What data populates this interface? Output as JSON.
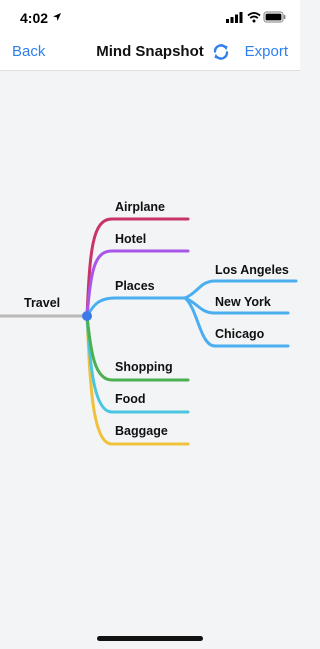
{
  "status": {
    "time": "4:02"
  },
  "nav": {
    "back_label": "Back",
    "title": "Mind Snapshot",
    "export_label": "Export",
    "sync_icon": "sync-icon"
  },
  "mindmap": {
    "root": "Travel",
    "nodes": [
      {
        "label": "Airplane",
        "color": "#c8336a"
      },
      {
        "label": "Hotel",
        "color": "#a855e8"
      },
      {
        "label": "Places",
        "color": "#4aaef0",
        "children": [
          "Los Angeles",
          "New York",
          "Chicago"
        ]
      },
      {
        "label": "Shopping",
        "color": "#4caf50"
      },
      {
        "label": "Food",
        "color": "#4cc6e0"
      },
      {
        "label": "Baggage",
        "color": "#f0c23b"
      }
    ],
    "root_line_color": "#b9b9b9",
    "root_dot_color": "#3b7be8"
  }
}
